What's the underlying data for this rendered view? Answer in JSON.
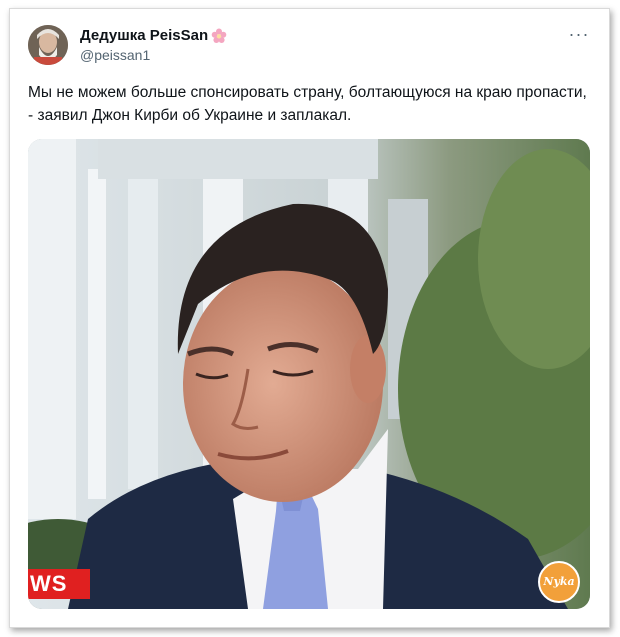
{
  "post": {
    "author_name": "Дедушка PeisSan",
    "author_handle": "@peissan1",
    "more_icon": "ellipsis-icon",
    "text": "Мы не можем больше спонсировать страну, болтающуюся на краю пропасти, - заявил Джон Кирби об Украине и заплакал.",
    "name_badge_icon": "pink-flower-icon"
  },
  "media": {
    "news_badge": "WS",
    "watermark": "Nyka"
  },
  "colors": {
    "text": "#0f1419",
    "secondary": "#536471",
    "news_red": "#e02020",
    "watermark_orange": "#f2a03a"
  }
}
